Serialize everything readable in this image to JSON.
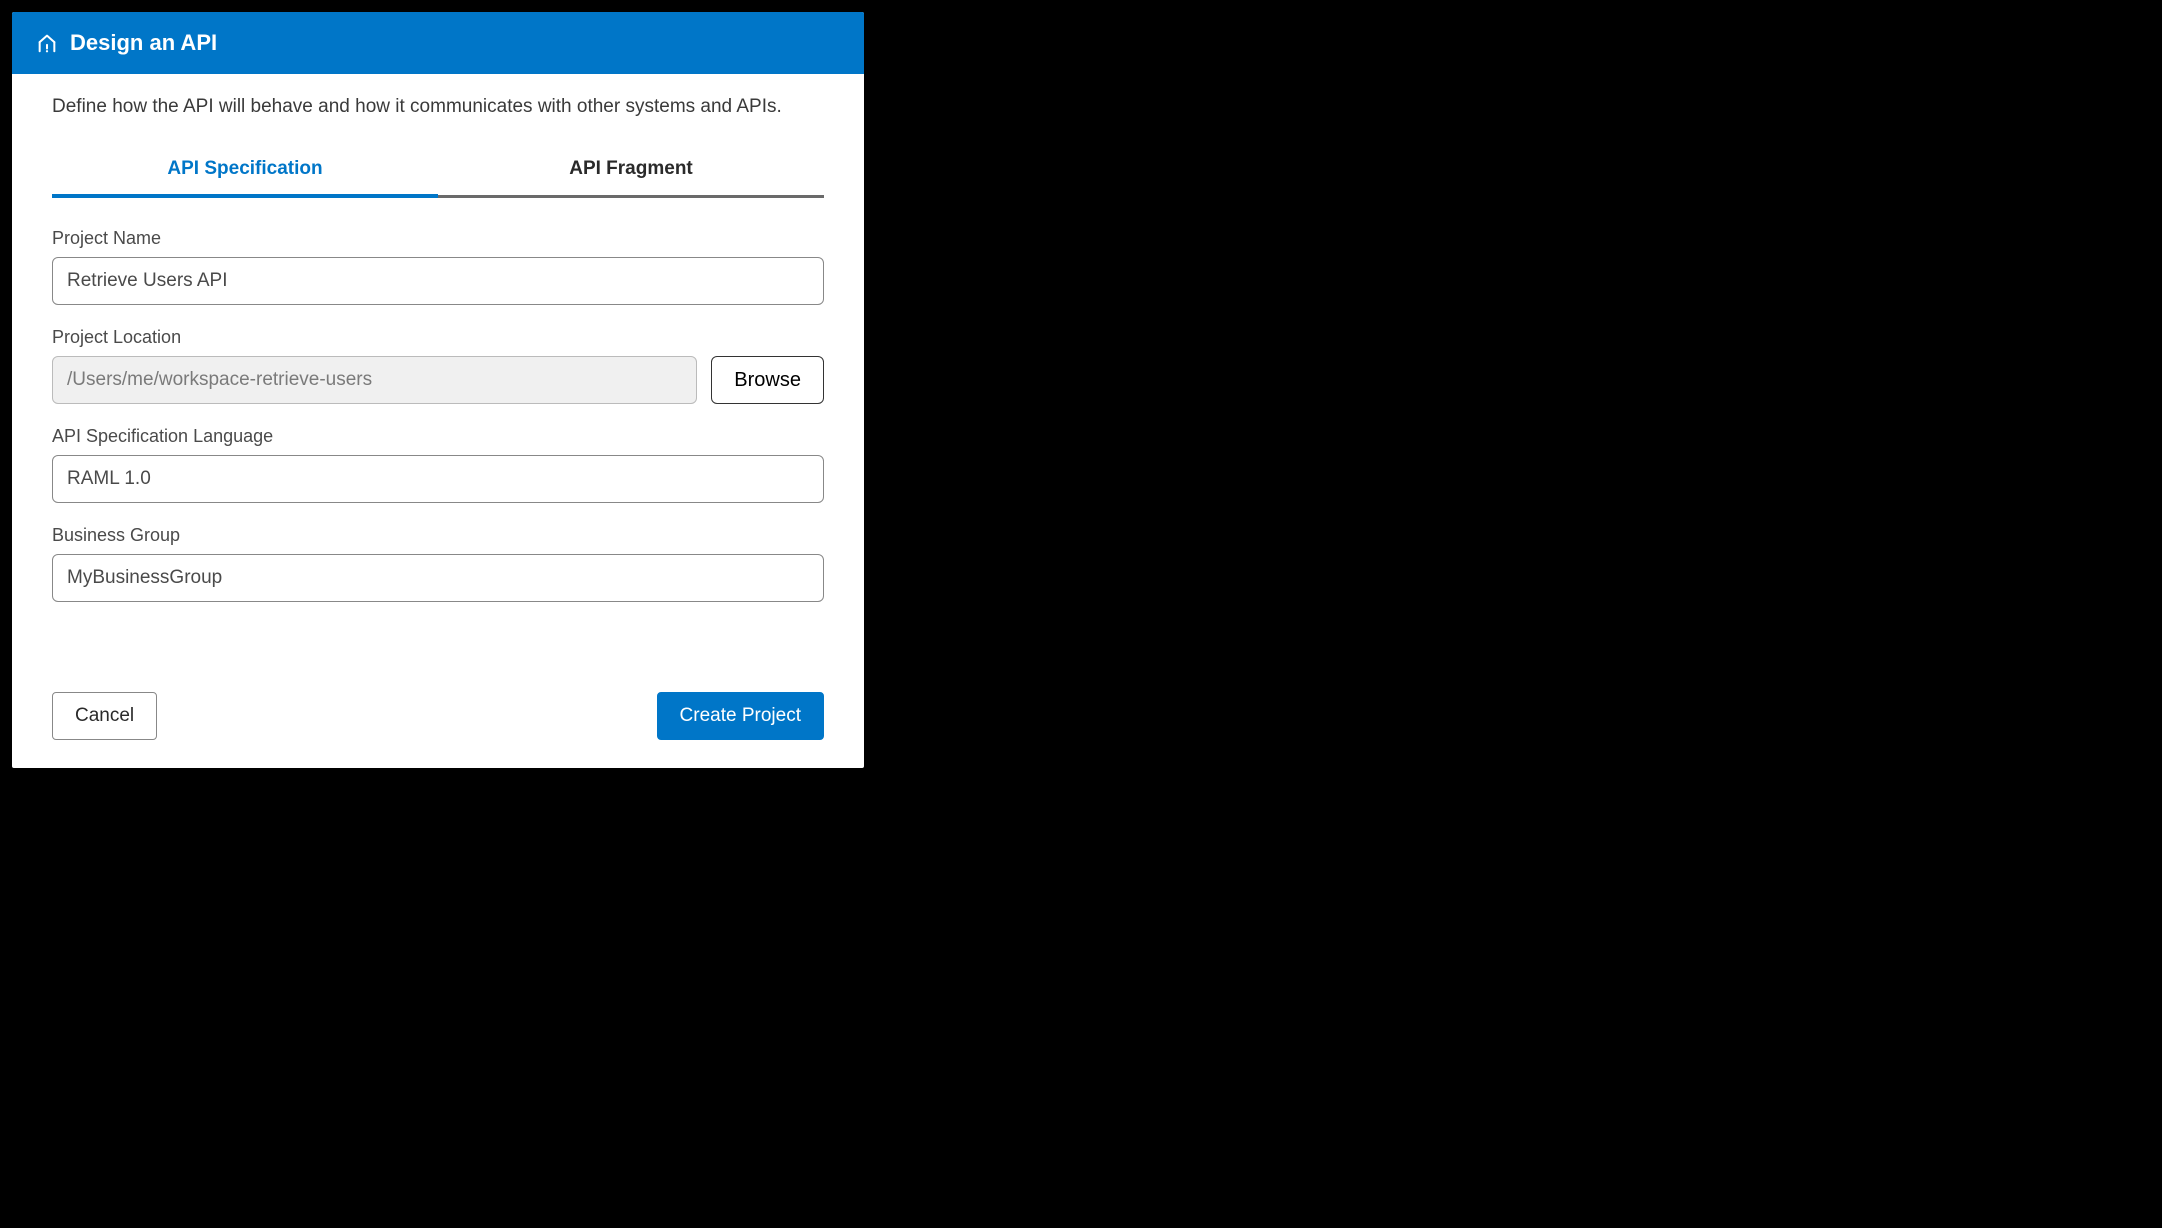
{
  "header": {
    "title": "Design an API"
  },
  "description": "Define how the API will behave and how it communicates with other systems and APIs.",
  "tabs": {
    "spec": "API Specification",
    "fragment": "API Fragment"
  },
  "form": {
    "project_name": {
      "label": "Project Name",
      "value": "Retrieve Users API"
    },
    "project_location": {
      "label": "Project Location",
      "value": "/Users/me/workspace-retrieve-users",
      "browse_label": "Browse"
    },
    "api_spec_language": {
      "label": "API Specification Language",
      "value": "RAML 1.0"
    },
    "business_group": {
      "label": "Business Group",
      "value": "MyBusinessGroup"
    }
  },
  "footer": {
    "cancel": "Cancel",
    "create": "Create Project"
  },
  "colors": {
    "primary": "#0076c8"
  }
}
